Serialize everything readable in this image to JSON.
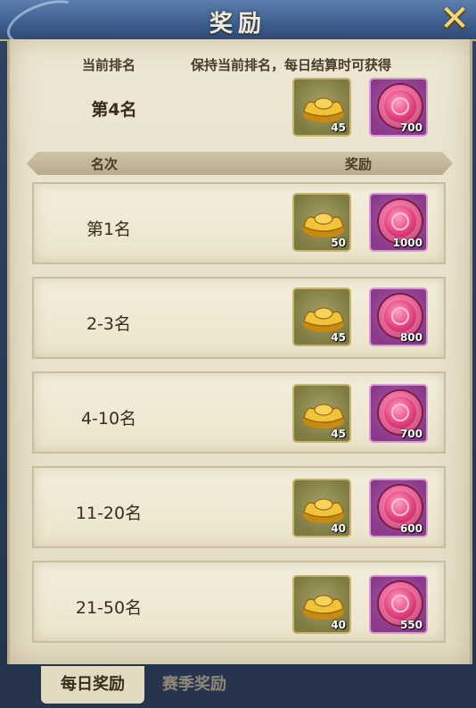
{
  "title": "奖励",
  "current": {
    "rank_label": "当前排名",
    "keep_label": "保持当前排名，每日结算时可获得",
    "rank_value": "第4名",
    "rewards": [
      {
        "icon": "gold-ingot-icon",
        "qty": "45"
      },
      {
        "icon": "pink-coin-icon",
        "qty": "700"
      }
    ]
  },
  "table": {
    "col_rank": "名次",
    "col_reward": "奖励",
    "rows": [
      {
        "label": "第1名",
        "gold": "50",
        "coin": "1000"
      },
      {
        "label": "2-3名",
        "gold": "45",
        "coin": "800"
      },
      {
        "label": "4-10名",
        "gold": "45",
        "coin": "700"
      },
      {
        "label": "11-20名",
        "gold": "40",
        "coin": "600"
      },
      {
        "label": "21-50名",
        "gold": "40",
        "coin": "550"
      }
    ]
  },
  "tabs": {
    "daily": "每日奖励",
    "season": "赛季奖励"
  },
  "close_icon": "close-icon",
  "colors": {
    "accent_gold": "#f3d776",
    "parchment": "#ece6d3",
    "title_bar": "#3e5f8e"
  }
}
